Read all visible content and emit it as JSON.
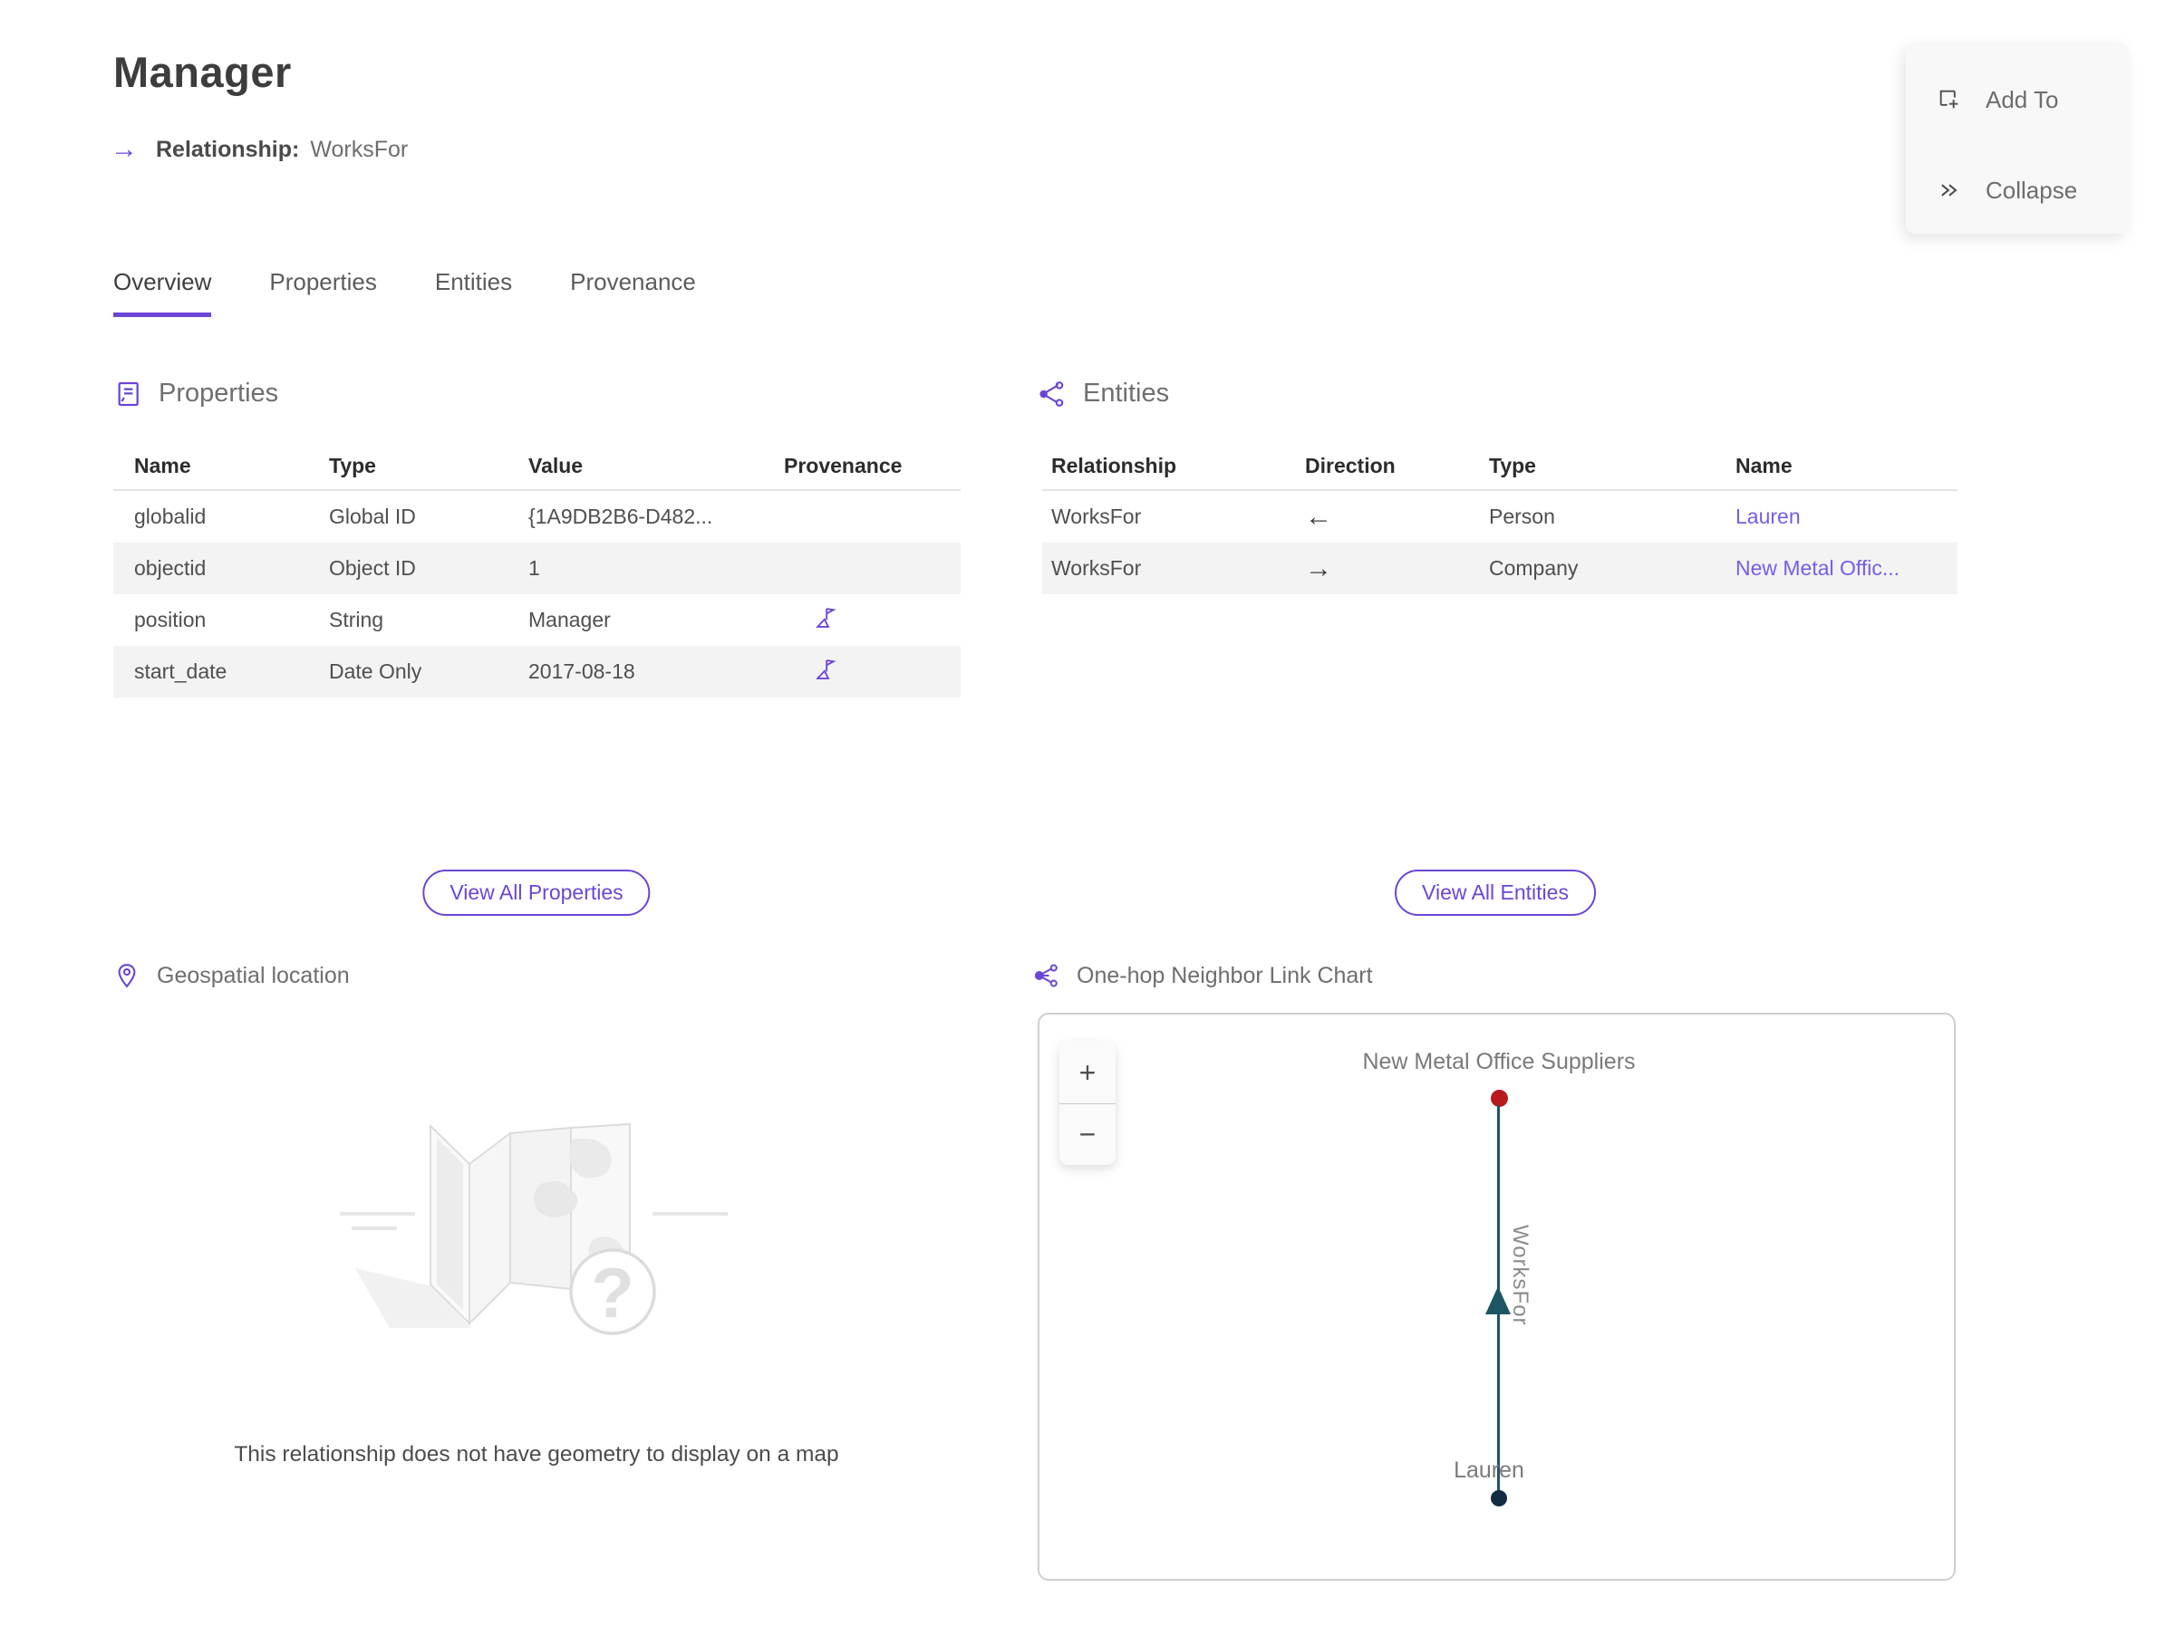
{
  "accent_color": "#6b46d6",
  "header": {
    "title": "Manager",
    "subtitle_label": "Relationship:",
    "subtitle_value": "WorksFor"
  },
  "actions": {
    "add_to": "Add To",
    "collapse": "Collapse"
  },
  "tabs": [
    {
      "label": "Overview",
      "active": true
    },
    {
      "label": "Properties",
      "active": false
    },
    {
      "label": "Entities",
      "active": false
    },
    {
      "label": "Provenance",
      "active": false
    }
  ],
  "properties_section": {
    "title": "Properties",
    "columns": [
      "Name",
      "Type",
      "Value",
      "Provenance"
    ],
    "rows": [
      {
        "name": "globalid",
        "type": "Global ID",
        "value": "{1A9DB2B6-D482...",
        "provenance": false
      },
      {
        "name": "objectid",
        "type": "Object ID",
        "value": "1",
        "provenance": false
      },
      {
        "name": "position",
        "type": "String",
        "value": "Manager",
        "provenance": true
      },
      {
        "name": "start_date",
        "type": "Date Only",
        "value": "2017-08-18",
        "provenance": true
      }
    ],
    "view_all": "View All Properties"
  },
  "entities_section": {
    "title": "Entities",
    "columns": [
      "Relationship",
      "Direction",
      "Type",
      "Name"
    ],
    "rows": [
      {
        "relationship": "WorksFor",
        "direction": "←",
        "type": "Person",
        "name": "Lauren"
      },
      {
        "relationship": "WorksFor",
        "direction": "→",
        "type": "Company",
        "name": "New Metal Offic..."
      }
    ],
    "view_all": "View All Entities"
  },
  "geospatial": {
    "title": "Geospatial location",
    "empty_message": "This relationship does not have geometry to display on a map"
  },
  "link_chart": {
    "title": "One-hop Neighbor Link Chart",
    "zoom_in": "+",
    "zoom_out": "−",
    "top_node": {
      "label": "New Metal Office Suppliers",
      "color": "#b8191d"
    },
    "bottom_node": {
      "label": "Lauren",
      "color": "#142c42"
    },
    "edge": {
      "label": "WorksFor",
      "color": "#1d5565"
    }
  }
}
